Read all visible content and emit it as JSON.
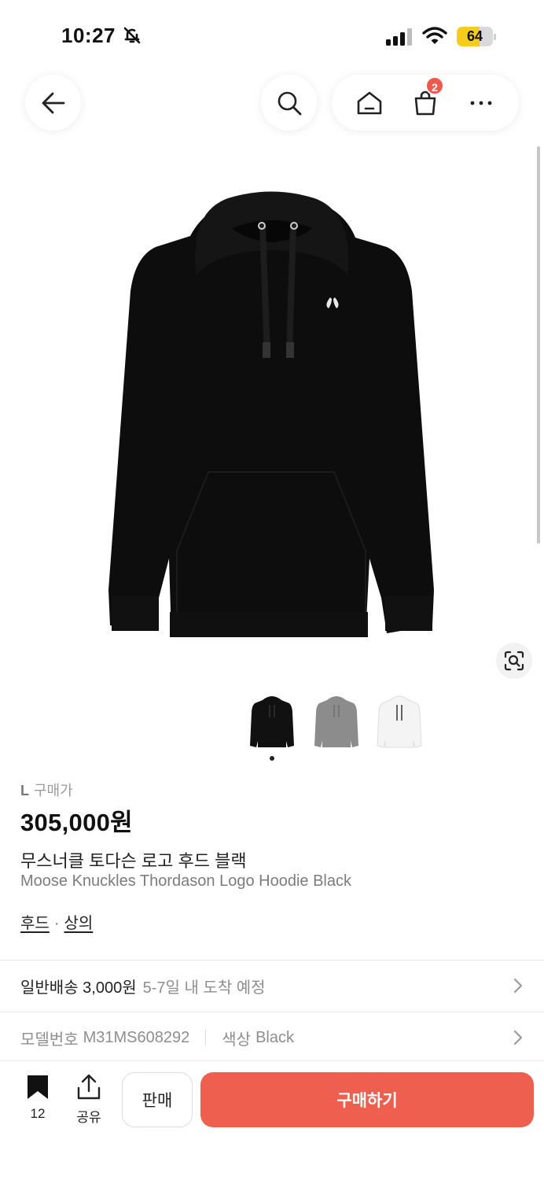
{
  "status_bar": {
    "time": "10:27",
    "battery": "64",
    "battery_level": 0.64,
    "battery_color": "#f5cc1c",
    "icons": [
      "bell-off-icon",
      "signal-icon",
      "wifi-icon",
      "battery-icon"
    ]
  },
  "nav": {
    "back_icon": "arrow-left-icon",
    "search_icon": "search-icon",
    "home_icon": "home-icon",
    "cart_icon": "shopping-bag-icon",
    "cart_badge": "2",
    "more_icon": "more-horizontal-icon"
  },
  "product": {
    "image": "black-hoodie-image",
    "thumbnails": [
      "black-hoodie-thumb",
      "grey-hoodie-thumb",
      "white-hoodie-thumb"
    ],
    "selected_thumbnail": 0,
    "size": "L",
    "price_label": "구매가",
    "price": "305,000원",
    "name_ko": "무스너클 토다슨 로고 후드 블랙",
    "name_en": "Moose Knuckles Thordason Logo Hoodie Black",
    "categories": [
      "후드",
      "상의"
    ],
    "category_separator": "·"
  },
  "shipping": {
    "label": "일반배송 3,000원",
    "eta": "5-7일 내 도착 예정"
  },
  "details": {
    "model_label": "모델번호",
    "model_value": "M31MS608292",
    "color_label": "색상",
    "color_value": "Black"
  },
  "bottom_bar": {
    "bookmark_count": "12",
    "share_label": "공유",
    "sell_label": "판매",
    "buy_label": "구매하기",
    "accent_color": "#ef5f50"
  }
}
